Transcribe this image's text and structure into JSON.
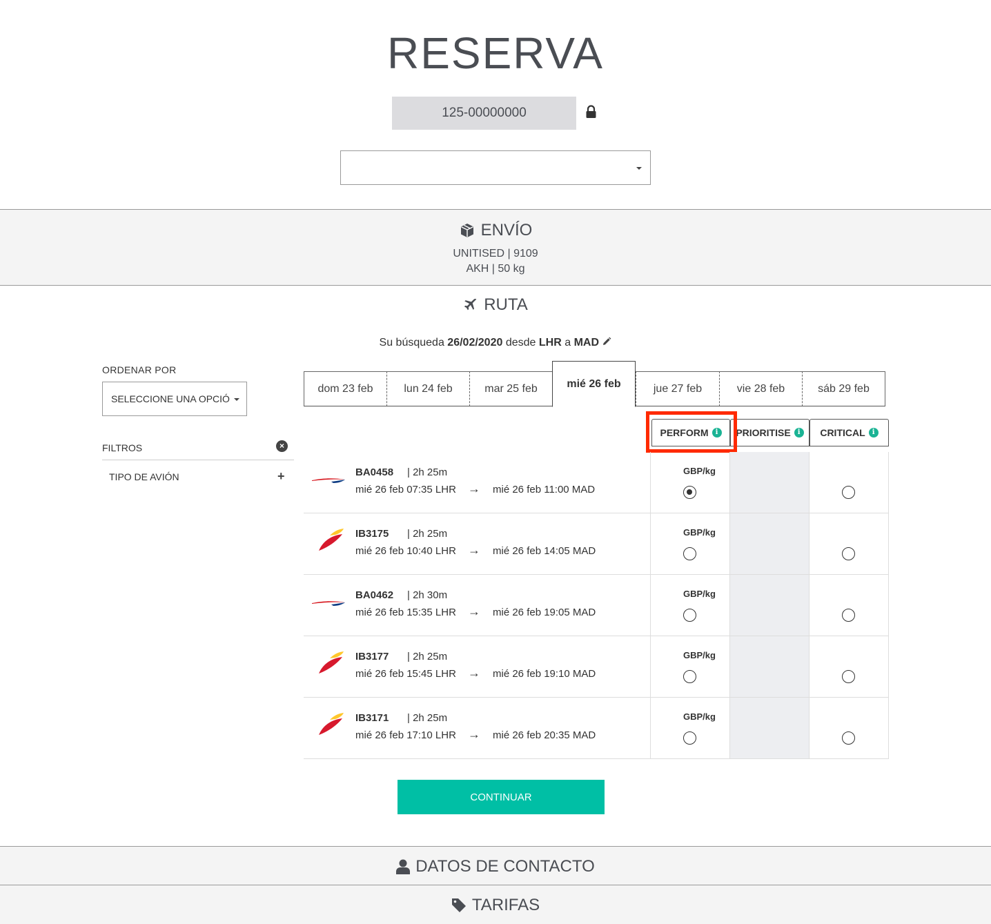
{
  "page": {
    "title": "RESERVA",
    "awb_number": "125-00000000",
    "top_select_value": ""
  },
  "envio": {
    "heading": "ENVÍO",
    "line1": "UNITISED | 9109",
    "line2": "AKH | 50 kg"
  },
  "ruta": {
    "heading": "RUTA",
    "search_prefix": "Su búsqueda",
    "search_date": "26/02/2020",
    "search_from_word": "desde",
    "search_origin": "LHR",
    "search_to_word": "a",
    "search_destination": "MAD"
  },
  "sidebar": {
    "sort_label": "ORDENAR POR",
    "sort_select": "SELECCIONE UNA OPCIÓ",
    "filters_label": "FILTROS",
    "filter_item": "TIPO DE AVIÓN"
  },
  "days": [
    {
      "label": "dom 23 feb"
    },
    {
      "label": "lun 24 feb"
    },
    {
      "label": "mar 25 feb"
    },
    {
      "label": "mié 26 feb",
      "active": true
    },
    {
      "label": "jue 27 feb"
    },
    {
      "label": "vie 28 feb"
    },
    {
      "label": "sáb 29 feb"
    }
  ],
  "services": [
    {
      "label": "PERFORM"
    },
    {
      "label": "PRIORITISE"
    },
    {
      "label": "CRITICAL"
    }
  ],
  "flights": [
    {
      "code": "BA0458",
      "duration": "| 2h 25m",
      "departure": "mié 26 feb 07:35 LHR",
      "arrival": "mié 26 feb 11:00 MAD",
      "price_unit": "GBP/kg",
      "airline_logo": "british-airways-logo",
      "perform_selected": true
    },
    {
      "code": "IB3175",
      "duration": "| 2h 25m",
      "departure": "mié 26 feb 10:40 LHR",
      "arrival": "mié 26 feb 14:05 MAD",
      "price_unit": "GBP/kg",
      "airline_logo": "iberia-logo",
      "perform_selected": false
    },
    {
      "code": "BA0462",
      "duration": "| 2h 30m",
      "departure": "mié 26 feb 15:35 LHR",
      "arrival": "mié 26 feb 19:05 MAD",
      "price_unit": "GBP/kg",
      "airline_logo": "british-airways-logo",
      "perform_selected": false
    },
    {
      "code": "IB3177",
      "duration": "| 2h 25m",
      "departure": "mié 26 feb 15:45 LHR",
      "arrival": "mié 26 feb 19:10 MAD",
      "price_unit": "GBP/kg",
      "airline_logo": "iberia-logo",
      "perform_selected": false
    },
    {
      "code": "IB3171",
      "duration": "| 2h 25m",
      "departure": "mié 26 feb 17:10 LHR",
      "arrival": "mié 26 feb 20:35 MAD",
      "price_unit": "GBP/kg",
      "airline_logo": "iberia-logo",
      "perform_selected": false
    }
  ],
  "continue_label": "CONTINUAR",
  "sections": {
    "contact": "DATOS DE CONTACTO",
    "rates": "TARIFAS"
  },
  "colors": {
    "accent": "#00bfa5",
    "info": "#1ab394",
    "highlight": "#ff2a00"
  }
}
